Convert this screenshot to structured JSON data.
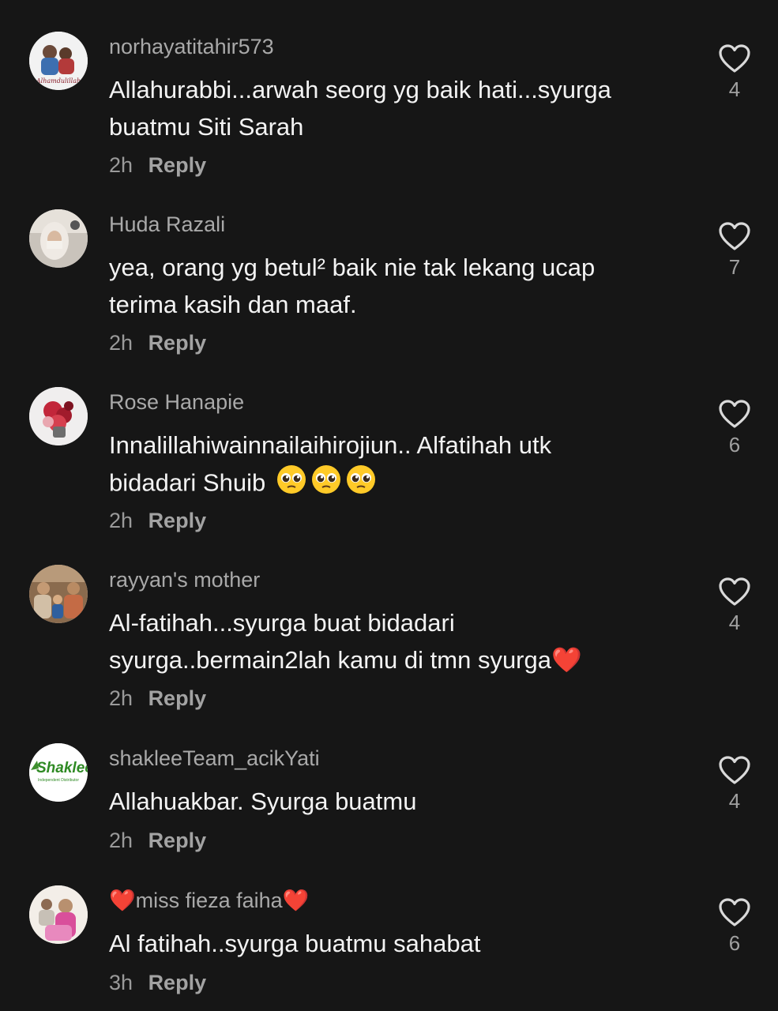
{
  "comments": [
    {
      "username": "norhayatitahir573",
      "text_lines": [
        "Allahurabbi...arwah seorg yg baik hati...syurga",
        "buatmu Siti Sarah"
      ],
      "time": "2h",
      "reply_label": "Reply",
      "likes": "4",
      "avatar_text": "Alhamdulillah"
    },
    {
      "username": "Huda Razali",
      "text_lines": [
        "yea, orang yg betul² baik nie tak lekang ucap",
        "terima kasih dan maaf."
      ],
      "time": "2h",
      "reply_label": "Reply",
      "likes": "7"
    },
    {
      "username": "Rose Hanapie",
      "text_lines": [
        "Innalillahiwainnailaihirojiun.. Alfatihah utk",
        "bidadari Shuib"
      ],
      "time": "2h",
      "reply_label": "Reply",
      "likes": "6"
    },
    {
      "username": "rayyan's mother",
      "text_lines": [
        "Al-fatihah...syurga buat bidadari",
        "syurga..bermain2lah kamu di tmn syurga"
      ],
      "time": "2h",
      "reply_label": "Reply",
      "likes": "4"
    },
    {
      "username": "shakleeTeam_acikYati",
      "text_lines": [
        "Allahuakbar. Syurga buatmu"
      ],
      "time": "2h",
      "reply_label": "Reply",
      "likes": "4",
      "avatar_text": "Shaklee",
      "avatar_subtext": "Independent Distributor"
    },
    {
      "username": "miss fieza faiha",
      "text_lines": [
        "Al fatihah..syurga buatmu sahabat"
      ],
      "time": "3h",
      "reply_label": "Reply",
      "likes": "6"
    }
  ],
  "icons": {
    "like": "heart-outline-icon",
    "emoji_heart": "❤️",
    "emoji_pleading": "pleading-face-emoji"
  },
  "colors": {
    "background": "#161616",
    "username": "#a9a9a9",
    "text": "#f3f3f3",
    "muted": "#9a9a9a",
    "heart_red": "#e3242b"
  }
}
